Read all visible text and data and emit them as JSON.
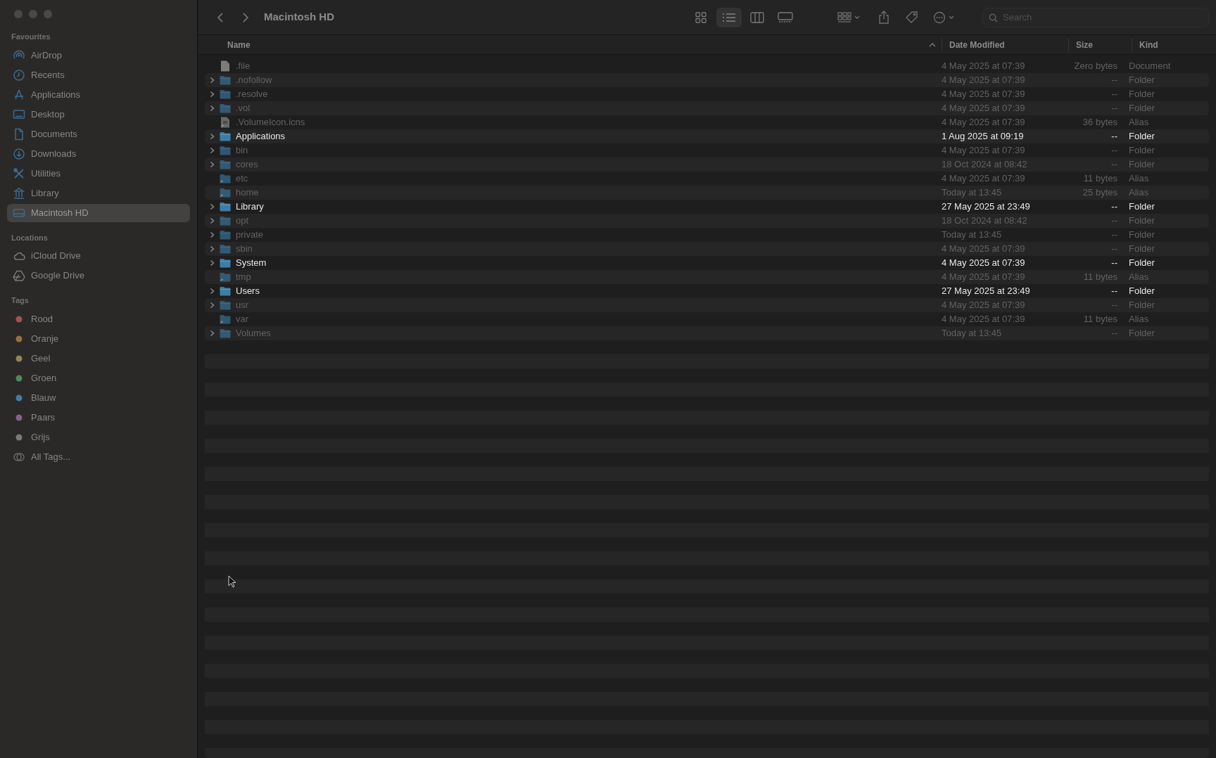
{
  "window": {
    "title": "Macintosh HD"
  },
  "sidebar": {
    "sections": [
      {
        "title": "Favourites",
        "items": [
          {
            "label": "AirDrop",
            "kind": "airdrop",
            "selected": false
          },
          {
            "label": "Recents",
            "kind": "clock",
            "selected": false
          },
          {
            "label": "Applications",
            "kind": "apps",
            "selected": false
          },
          {
            "label": "Desktop",
            "kind": "desktop",
            "selected": false
          },
          {
            "label": "Documents",
            "kind": "document",
            "selected": false
          },
          {
            "label": "Downloads",
            "kind": "download",
            "selected": false
          },
          {
            "label": "Utilities",
            "kind": "tools",
            "selected": false
          },
          {
            "label": "Library",
            "kind": "library",
            "selected": false
          },
          {
            "label": "Macintosh HD",
            "kind": "disk",
            "selected": true
          }
        ]
      },
      {
        "title": "Locations",
        "items": [
          {
            "label": "iCloud Drive",
            "kind": "cloud",
            "selected": false
          },
          {
            "label": "Google Drive",
            "kind": "drive",
            "selected": false
          }
        ]
      },
      {
        "title": "Tags",
        "items": [
          {
            "label": "Rood",
            "kind": "tag",
            "color": "#a4524f",
            "selected": false
          },
          {
            "label": "Oranje",
            "kind": "tag",
            "color": "#9c6d3c",
            "selected": false
          },
          {
            "label": "Geel",
            "kind": "tag",
            "color": "#8c8758",
            "selected": false
          },
          {
            "label": "Groen",
            "kind": "tag",
            "color": "#4f8a5c",
            "selected": false
          },
          {
            "label": "Blauw",
            "kind": "tag",
            "color": "#3f7fa6",
            "selected": false
          },
          {
            "label": "Paars",
            "kind": "tag",
            "color": "#86608f",
            "selected": false
          },
          {
            "label": "Grijs",
            "kind": "tag",
            "color": "#7a7a7a",
            "selected": false
          },
          {
            "label": "All Tags...",
            "kind": "alltags",
            "selected": false
          }
        ]
      }
    ]
  },
  "toolbar": {
    "views": [
      {
        "kind": "icons",
        "selected": false
      },
      {
        "kind": "list",
        "selected": true
      },
      {
        "kind": "columns",
        "selected": false
      },
      {
        "kind": "gallery",
        "selected": false
      }
    ],
    "search": {
      "placeholder": "Search"
    }
  },
  "table": {
    "columns": [
      {
        "label": "Name",
        "sorted": true
      },
      {
        "label": "Date Modified",
        "sorted": false
      },
      {
        "label": "Size",
        "sorted": false
      },
      {
        "label": "Kind",
        "sorted": false
      }
    ],
    "rows": [
      {
        "name": ".file",
        "kind": "file",
        "expandable": false,
        "dimmed": true,
        "date_modified": "4 May 2025 at 07:39",
        "size": "Zero bytes",
        "kind_label": "Document"
      },
      {
        "name": ".nofollow",
        "kind": "folder",
        "expandable": true,
        "dimmed": true,
        "date_modified": "4 May 2025 at 07:39",
        "size": "--",
        "kind_label": "Folder"
      },
      {
        "name": ".resolve",
        "kind": "folder",
        "expandable": true,
        "dimmed": true,
        "date_modified": "4 May 2025 at 07:39",
        "size": "--",
        "kind_label": "Folder"
      },
      {
        "name": ".vol",
        "kind": "folder",
        "expandable": true,
        "dimmed": true,
        "date_modified": "4 May 2025 at 07:39",
        "size": "--",
        "kind_label": "Folder"
      },
      {
        "name": ".VolumeIcon.icns",
        "kind": "filealias",
        "expandable": false,
        "dimmed": true,
        "date_modified": "4 May 2025 at 07:39",
        "size": "36 bytes",
        "kind_label": "Alias"
      },
      {
        "name": "Applications",
        "kind": "folder",
        "expandable": true,
        "dimmed": false,
        "date_modified": "1 Aug 2025 at 09:19",
        "size": "--",
        "kind_label": "Folder"
      },
      {
        "name": "bin",
        "kind": "folder",
        "expandable": true,
        "dimmed": true,
        "date_modified": "4 May 2025 at 07:39",
        "size": "--",
        "kind_label": "Folder"
      },
      {
        "name": "cores",
        "kind": "folder",
        "expandable": true,
        "dimmed": true,
        "date_modified": "18 Oct 2024 at 08:42",
        "size": "--",
        "kind_label": "Folder"
      },
      {
        "name": "etc",
        "kind": "folderalias",
        "expandable": false,
        "dimmed": true,
        "date_modified": "4 May 2025 at 07:39",
        "size": "11 bytes",
        "kind_label": "Alias"
      },
      {
        "name": "home",
        "kind": "folderalias",
        "expandable": false,
        "dimmed": true,
        "date_modified": "Today at 13:45",
        "size": "25 bytes",
        "kind_label": "Alias"
      },
      {
        "name": "Library",
        "kind": "folder",
        "expandable": true,
        "dimmed": false,
        "date_modified": "27 May 2025 at 23:49",
        "size": "--",
        "kind_label": "Folder"
      },
      {
        "name": "opt",
        "kind": "folder",
        "expandable": true,
        "dimmed": true,
        "date_modified": "18 Oct 2024 at 08:42",
        "size": "--",
        "kind_label": "Folder"
      },
      {
        "name": "private",
        "kind": "folder",
        "expandable": true,
        "dimmed": true,
        "date_modified": "Today at 13:45",
        "size": "--",
        "kind_label": "Folder"
      },
      {
        "name": "sbin",
        "kind": "folder",
        "expandable": true,
        "dimmed": true,
        "date_modified": "4 May 2025 at 07:39",
        "size": "--",
        "kind_label": "Folder"
      },
      {
        "name": "System",
        "kind": "folder",
        "expandable": true,
        "dimmed": false,
        "date_modified": "4 May 2025 at 07:39",
        "size": "--",
        "kind_label": "Folder"
      },
      {
        "name": "tmp",
        "kind": "folderalias",
        "expandable": false,
        "dimmed": true,
        "date_modified": "4 May 2025 at 07:39",
        "size": "11 bytes",
        "kind_label": "Alias"
      },
      {
        "name": "Users",
        "kind": "folder",
        "expandable": true,
        "dimmed": false,
        "date_modified": "27 May 2025 at 23:49",
        "size": "--",
        "kind_label": "Folder"
      },
      {
        "name": "usr",
        "kind": "folder",
        "expandable": true,
        "dimmed": true,
        "date_modified": "4 May 2025 at 07:39",
        "size": "--",
        "kind_label": "Folder"
      },
      {
        "name": "var",
        "kind": "folderalias",
        "expandable": false,
        "dimmed": true,
        "date_modified": "4 May 2025 at 07:39",
        "size": "11 bytes",
        "kind_label": "Alias"
      },
      {
        "name": "Volumes",
        "kind": "folder",
        "expandable": true,
        "dimmed": true,
        "date_modified": "Today at 13:45",
        "size": "--",
        "kind_label": "Folder"
      }
    ]
  }
}
